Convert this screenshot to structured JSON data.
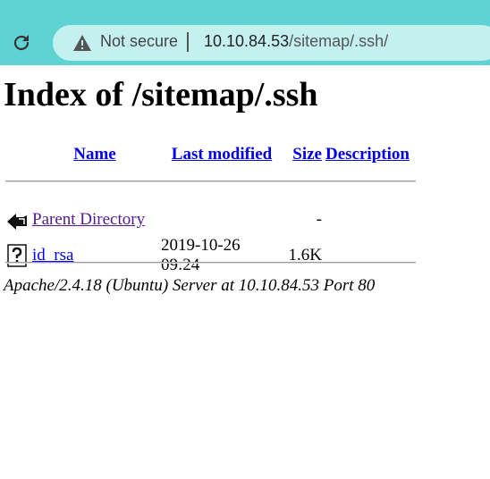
{
  "browser": {
    "security_label": "Not secure",
    "url_host": "10.10.84.53",
    "url_path": "/sitemap/.ssh/"
  },
  "page": {
    "title": "Index of /sitemap/.ssh",
    "columns": [
      "Name",
      "Last modified",
      "Size",
      "Description"
    ],
    "rows": [
      {
        "icon": "back-icon",
        "name": "Parent Directory",
        "modified": "",
        "size": "-",
        "description": ""
      },
      {
        "icon": "unknown-file-icon",
        "name": "id_rsa",
        "modified": "2019-10-26 09:24",
        "size": "1.6K",
        "description": ""
      }
    ],
    "footer": "Apache/2.4.18 (Ubuntu) Server at 10.10.84.53 Port 80"
  }
}
